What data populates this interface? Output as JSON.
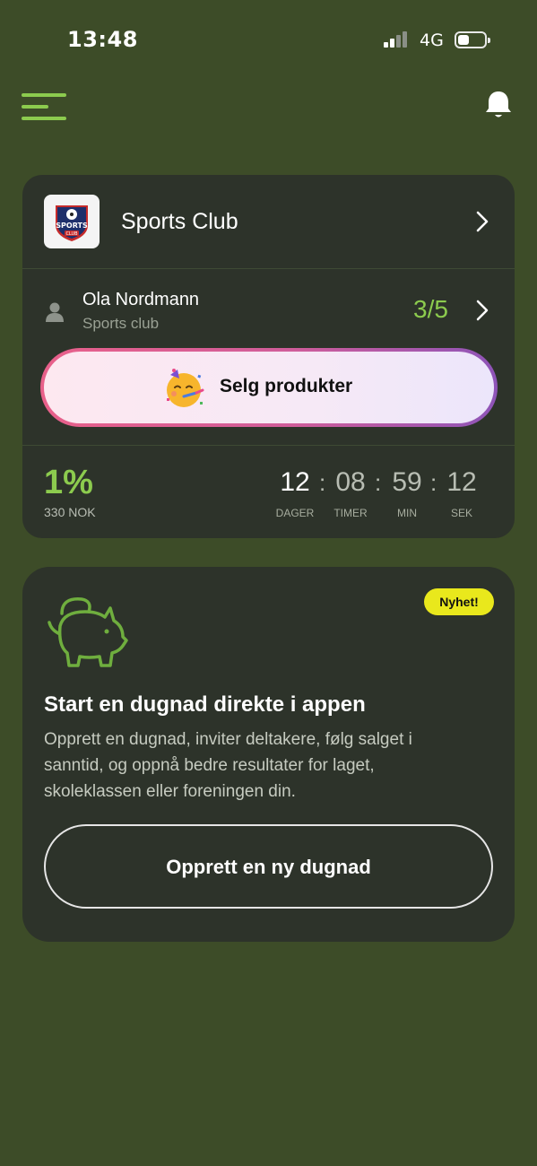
{
  "status_bar": {
    "time": "13:48",
    "network": "4G"
  },
  "header": {
    "menu_icon": "menu-icon",
    "bell_icon": "bell-icon"
  },
  "club_card": {
    "club_name": "Sports Club",
    "logo_text_top": "SPORTS",
    "logo_text_bottom": "CLUB",
    "member": {
      "name": "Ola Nordmann",
      "club": "Sports club",
      "progress": "3/5"
    },
    "sell_button": "Selg produkter",
    "stats": {
      "percent": "1%",
      "amount": "330 NOK"
    },
    "countdown": {
      "days": "12",
      "hours": "08",
      "minutes": "59",
      "seconds": "12",
      "labels": {
        "days": "DAGER",
        "hours": "TIMER",
        "minutes": "MIN",
        "seconds": "SEK"
      },
      "separator": ":"
    }
  },
  "promo_card": {
    "badge": "Nyhet!",
    "title": "Start en dugnad direkte i appen",
    "text": "Opprett en dugnad, inviter deltakere, følg salget i sanntid, og oppnå bedre resultater for laget, skoleklassen eller foreningen din.",
    "button": "Opprett en ny dugnad"
  },
  "colors": {
    "background": "#3d4c28",
    "card": "#2d332a",
    "accent": "#8ccb4e",
    "badge": "#e9e81c"
  }
}
